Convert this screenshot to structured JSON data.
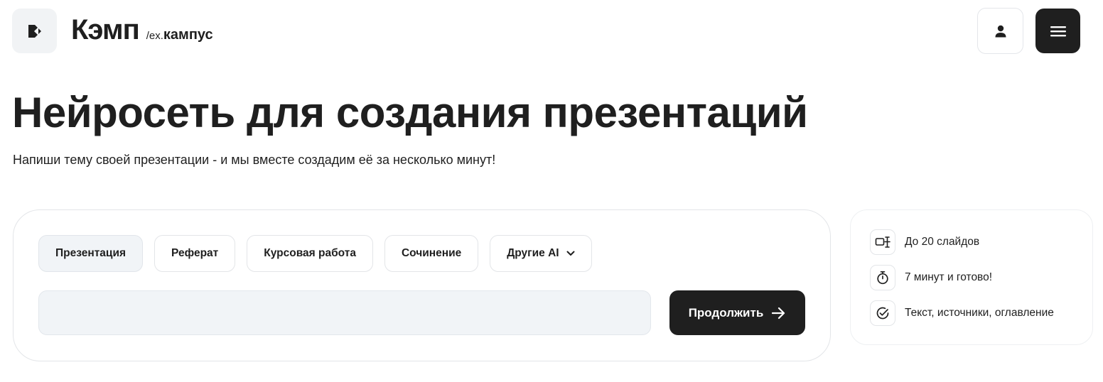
{
  "header": {
    "brand_name": "Кэмп",
    "brand_prefix": "/ex.",
    "brand_old_name": "кампус",
    "logo_icon": "k-logo-icon",
    "profile_icon": "user-icon",
    "menu_icon": "hamburger-icon"
  },
  "hero": {
    "title": "Нейросеть для создания презентаций",
    "subtitle": "Напиши тему своей презентации - и мы вместе создадим её за несколько минут!"
  },
  "generator": {
    "tabs": [
      {
        "label": "Презентация",
        "active": true
      },
      {
        "label": "Реферат",
        "active": false
      },
      {
        "label": "Курсовая работа",
        "active": false
      },
      {
        "label": "Сочинение",
        "active": false
      },
      {
        "label": "Другие AI",
        "active": false,
        "has_dropdown": true
      }
    ],
    "topic_input": {
      "value": "",
      "placeholder": ""
    },
    "continue_label": "Продолжить",
    "continue_icon": "arrow-right-icon"
  },
  "features": [
    {
      "icon": "slides-icon",
      "text": "До 20 слайдов"
    },
    {
      "icon": "stopwatch-icon",
      "text": "7 минут и готово!"
    },
    {
      "icon": "check-circle-icon",
      "text": "Текст, источники, оглавление"
    }
  ],
  "colors": {
    "dark": "#1f1f1f",
    "light_bg": "#f1f4f7",
    "border": "#e3e5e8",
    "white": "#ffffff"
  }
}
